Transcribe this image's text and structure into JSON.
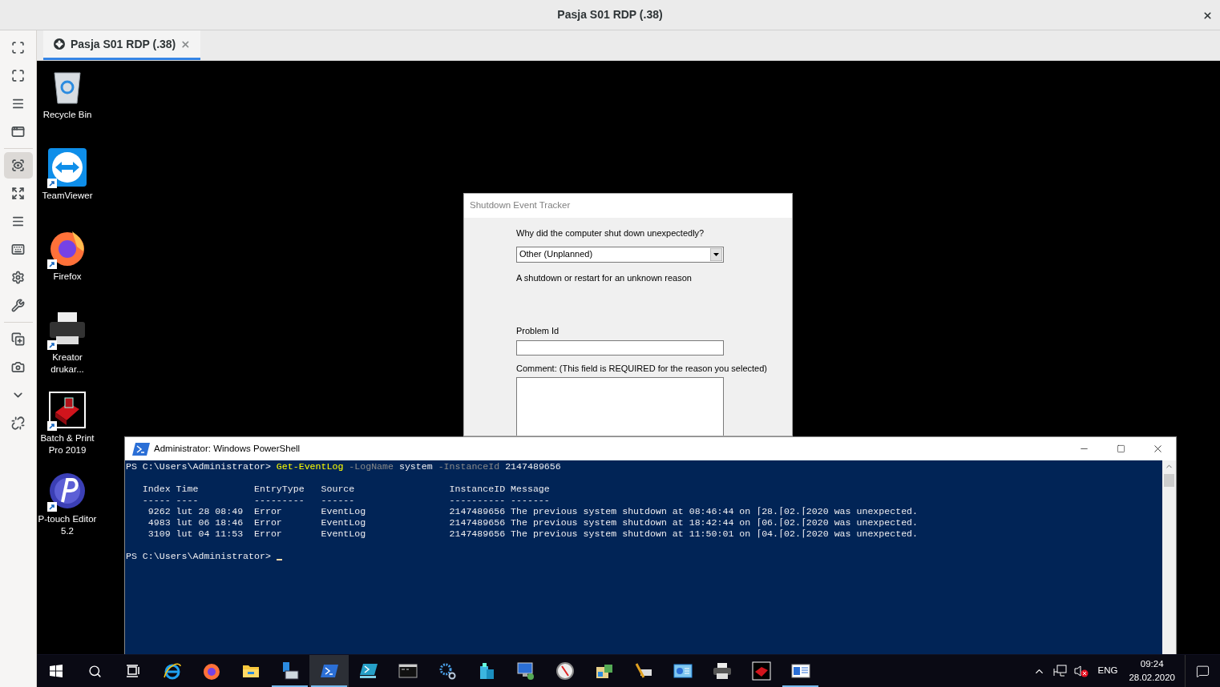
{
  "window": {
    "title": "Pasja S01 RDP (.38)"
  },
  "toolbar": {
    "groups": [
      [
        {
          "selected": false
        },
        {
          "selected": false
        },
        {
          "selected": false
        },
        {
          "selected": false
        }
      ],
      [
        {
          "selected": true
        },
        {
          "selected": false
        },
        {
          "selected": false
        },
        {
          "selected": false
        },
        {
          "selected": false
        },
        {
          "selected": false
        }
      ],
      [
        {
          "selected": false
        },
        {
          "selected": false
        },
        {
          "selected": false
        },
        {
          "selected": false
        }
      ]
    ]
  },
  "tabs": [
    {
      "label": "Pasja S01 RDP (.38)",
      "selected": true
    }
  ],
  "desktop_icons": [
    {
      "label": "Recycle Bin",
      "shortcut": false
    },
    {
      "label": "TeamViewer",
      "shortcut": true
    },
    {
      "label": "Firefox",
      "shortcut": true
    },
    {
      "label": "Kreator drukar...",
      "shortcut": true
    },
    {
      "label": "Batch & Print Pro 2019",
      "shortcut": true
    },
    {
      "label": "P-touch Editor 5.2",
      "shortcut": true
    }
  ],
  "dialog": {
    "title": "Shutdown Event Tracker",
    "question": "Why did the computer shut down unexpectedly?",
    "reason": "Other (Unplanned)",
    "description": "A shutdown or restart for an unknown reason",
    "problem_id_label": "Problem Id",
    "comment_label": "Comment: (This field is REQUIRED for the reason you selected)"
  },
  "powershell": {
    "title": "Administrator: Windows PowerShell",
    "blocks": [
      [
        {
          "segments": [
            {
              "text": "PS C:\\Users\\Administrator> ",
              "kind": "plain"
            },
            {
              "text": "Get-EventLog",
              "kind": "command"
            },
            {
              "text": " -LogName",
              "kind": "parameter"
            },
            {
              "text": " system",
              "kind": "plain"
            },
            {
              "text": " -InstanceId",
              "kind": "parameter"
            },
            {
              "text": " 2147489656",
              "kind": "plain"
            }
          ]
        }
      ],
      [
        {
          "segments": [
            {
              "text": "   Index Time          EntryType   Source                 InstanceID Message",
              "kind": "plain"
            }
          ]
        },
        {
          "segments": [
            {
              "text": "   ----- ----          ---------   ------                 ---------- -------",
              "kind": "plain"
            }
          ]
        },
        {
          "segments": [
            {
              "text": "    9262 lut 28 08:49  Error       EventLog               2147489656 The previous system shutdown at 08:46:44 on ⌈28.⌈02.⌈2020 was unexpected.",
              "kind": "plain"
            }
          ]
        },
        {
          "segments": [
            {
              "text": "    4983 lut 06 18:46  Error       EventLog               2147489656 The previous system shutdown at 18:42:44 on ⌈06.⌈02.⌈2020 was unexpected.",
              "kind": "plain"
            }
          ]
        },
        {
          "segments": [
            {
              "text": "    3109 lut 04 11:53  Error       EventLog               2147489656 The previous system shutdown at 11:50:01 on ⌈04.⌈02.⌈2020 was unexpected.",
              "kind": "plain"
            }
          ]
        }
      ],
      [
        {
          "segments": [
            {
              "text": "PS C:\\Users\\Administrator> ",
              "kind": "plain"
            }
          ],
          "cursor": true
        }
      ]
    ]
  },
  "taskbar": {
    "apps": [
      {
        "running": false,
        "selected": false
      },
      {
        "running": false,
        "selected": false
      },
      {
        "running": false,
        "selected": false
      },
      {
        "running": true,
        "selected": false
      },
      {
        "running": true,
        "selected": true
      },
      {
        "running": false,
        "selected": false
      },
      {
        "running": false,
        "selected": false
      },
      {
        "running": false,
        "selected": false
      },
      {
        "running": false,
        "selected": false
      },
      {
        "running": false,
        "selected": false
      },
      {
        "running": false,
        "selected": false
      },
      {
        "running": false,
        "selected": false
      },
      {
        "running": false,
        "selected": false
      },
      {
        "running": false,
        "selected": false
      },
      {
        "running": false,
        "selected": false
      },
      {
        "running": false,
        "selected": false
      },
      {
        "running": true,
        "selected": false
      }
    ],
    "language": "ENG",
    "time": "09:24",
    "date": "28.02.2020"
  }
}
